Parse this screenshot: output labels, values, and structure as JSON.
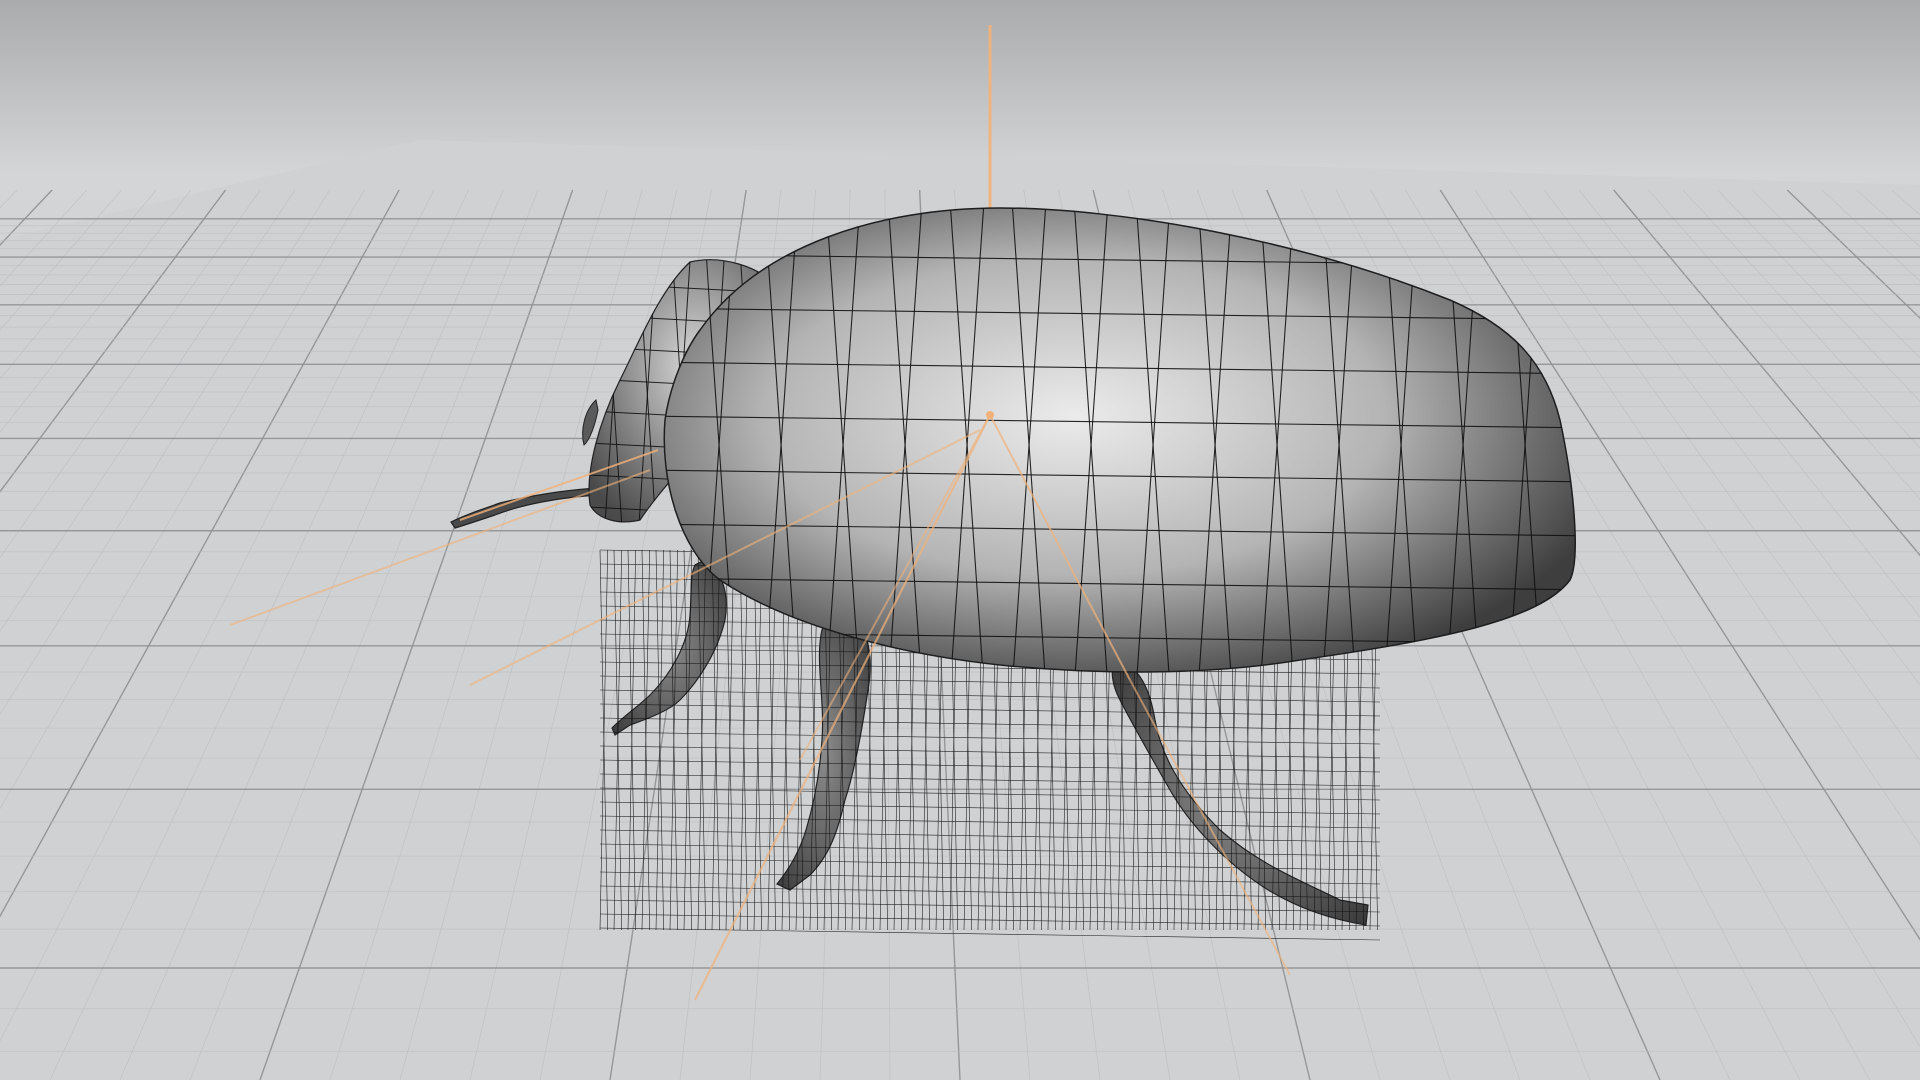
{
  "viewport": {
    "background_top": "#a9abad",
    "background_horizon": "#d6d8da",
    "floor_color": "#cfd1d3",
    "grid_minor_color": "#bcbec0",
    "grid_major_color": "#8e9092",
    "model_dark": "#3a3a3a",
    "model_light": "#e6e6e6",
    "wire_color": "#111111",
    "rig_color": "#f0b27a"
  },
  "scene": {
    "model": "beetle-mesh",
    "display_mode": "smooth-shaded-wireframe",
    "rig": "orange-bone-lines",
    "floor": "perspective-grid"
  }
}
